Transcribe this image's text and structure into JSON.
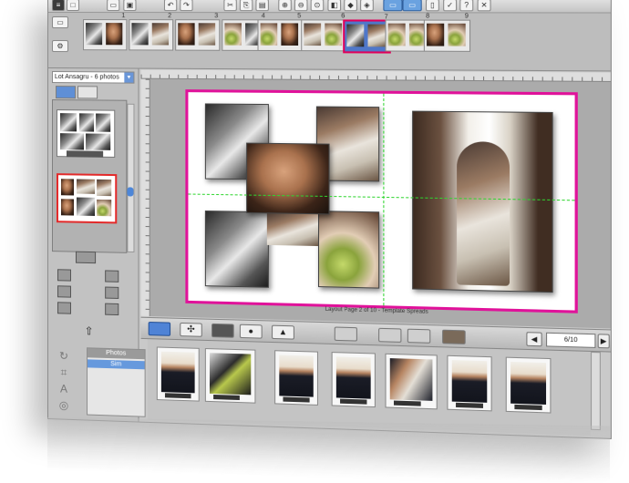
{
  "app": {
    "template_dropdown": "Lot Ansagru - 6 photos",
    "page_caption": "Layout Page 2 of 10 - Template Spreads",
    "page_counter": "6/10"
  },
  "folders": {
    "header": "Photos",
    "selected": "Sim"
  },
  "toolbar": {
    "icons": [
      "new-icon",
      "open-icon",
      "save-icon",
      "undo-icon",
      "redo-icon",
      "cut-icon",
      "copy-icon",
      "paste-icon",
      "zoom-in-icon",
      "zoom-out-icon",
      "zoom-fit-icon",
      "fill-icon",
      "flip-icon",
      "mirror-icon",
      "view-icon",
      "print-icon",
      "help-icon"
    ]
  },
  "spreads": {
    "numbers": [
      "1",
      "2",
      "3",
      "4",
      "5",
      "6",
      "7",
      "8",
      "9"
    ],
    "active_index": 6
  },
  "bottom_tools": {
    "icons": [
      "layout-icon",
      "butterfly-icon",
      "frame-icon",
      "shape-icon",
      "text-bubble-icon",
      "bird-icon",
      "left-page-icon",
      "blank-page-icon",
      "spread-icon",
      "right-page-icon"
    ]
  },
  "colors": {
    "accent_magenta": "#e0129a",
    "selection_red": "#e32a2a",
    "guide_green": "#2fd52f",
    "ui_blue": "#4f83d6"
  }
}
